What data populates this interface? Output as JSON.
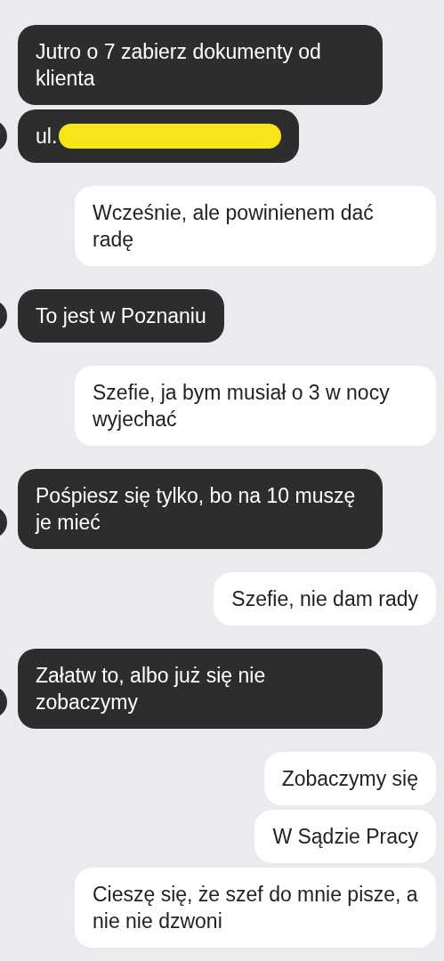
{
  "messages": [
    {
      "kind": "incoming",
      "avatar": false,
      "text": "Jutro o 7 zabierz dokumenty od klienta"
    },
    {
      "kind": "incoming",
      "avatar": true,
      "text": "ul.",
      "redacted": true
    },
    {
      "kind": "outgoing",
      "text": "Wcześnie, ale powinienem dać radę"
    },
    {
      "kind": "incoming",
      "avatar": true,
      "text": "To jest w Poznaniu"
    },
    {
      "kind": "outgoing",
      "text": "Szefie, ja bym musiał o 3 w nocy wyjechać"
    },
    {
      "kind": "incoming",
      "avatar": true,
      "text": "Pośpiesz się tylko, bo na 10 muszę je mieć"
    },
    {
      "kind": "outgoing",
      "text": "Szefie, nie dam rady"
    },
    {
      "kind": "incoming",
      "avatar": true,
      "text": "Załatw to, albo już się nie zobaczymy"
    },
    {
      "kind": "outgoing",
      "text": "Zobaczymy się"
    },
    {
      "kind": "outgoing",
      "text": "W Sądzie Pracy"
    },
    {
      "kind": "outgoing",
      "text": "Cieszę się, że szef do mnie pisze, a nie nie dzwoni"
    }
  ]
}
